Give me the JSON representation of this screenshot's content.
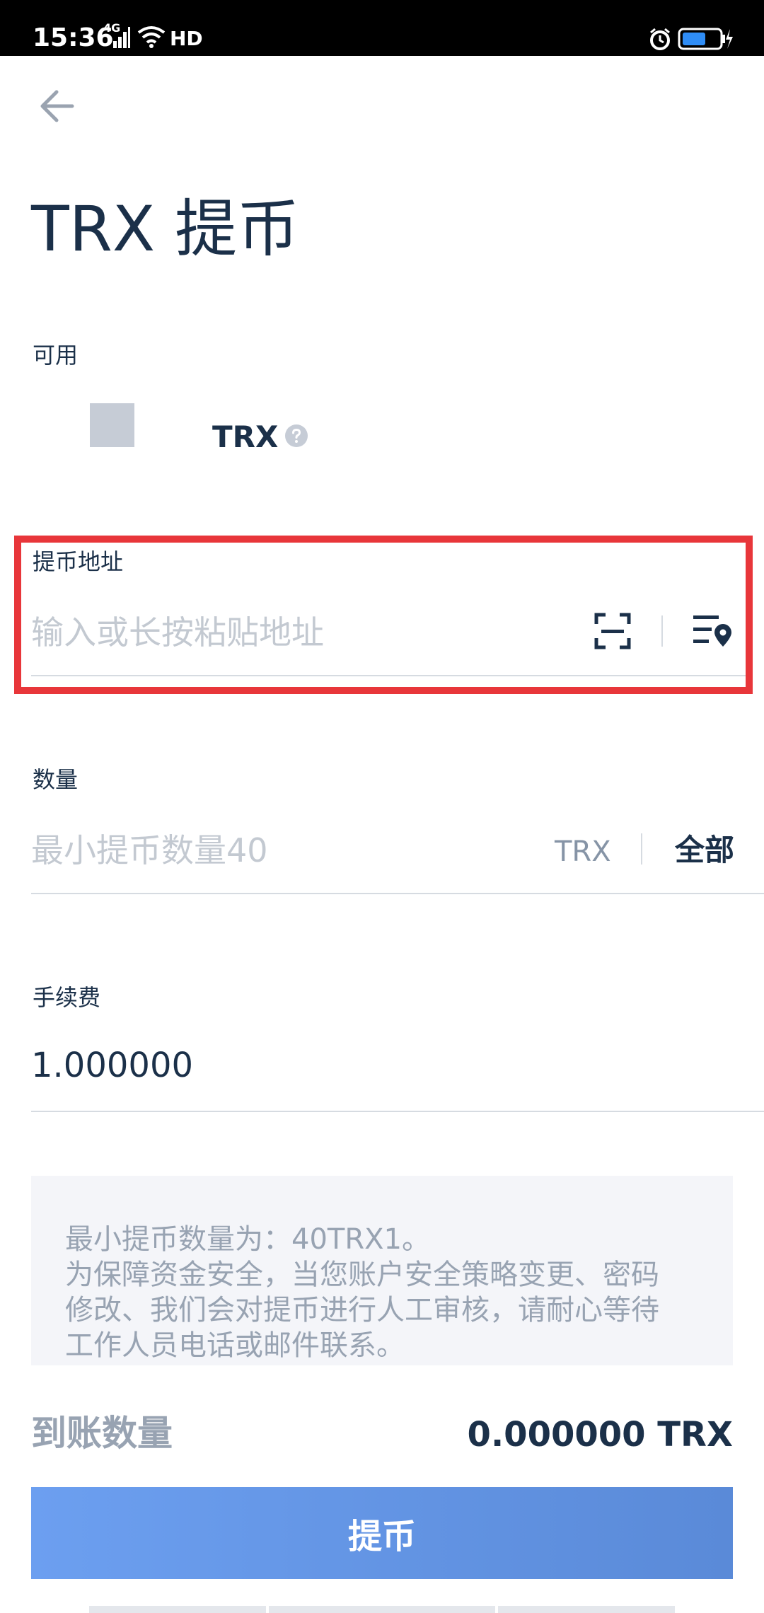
{
  "status_bar": {
    "time": "15:36",
    "network": "4G",
    "hd_badge": "HD"
  },
  "header": {
    "title": "TRX 提币"
  },
  "available": {
    "label": "可用",
    "unit": "TRX"
  },
  "address": {
    "label": "提币地址",
    "placeholder": "输入或长按粘贴地址"
  },
  "amount": {
    "label": "数量",
    "placeholder": "最小提币数量40",
    "unit": "TRX",
    "all_label": "全部"
  },
  "fee": {
    "label": "手续费",
    "value": "1.000000"
  },
  "notice": {
    "lines": [
      "最小提币数量为：40TRX1。",
      "为保障资金安全，当您账户安全策略变更、密码",
      "修改、我们会对提币进行人工审核，请耐心等待",
      "工作人员电话或邮件联系。"
    ]
  },
  "receive": {
    "label": "到账数量",
    "value": "0.000000 TRX"
  },
  "submit": {
    "label": "提币"
  },
  "colors": {
    "accent": "#6c9ff0",
    "text_primary": "#1b3049",
    "text_muted": "#98a3b2",
    "highlight": "#e8363a"
  }
}
